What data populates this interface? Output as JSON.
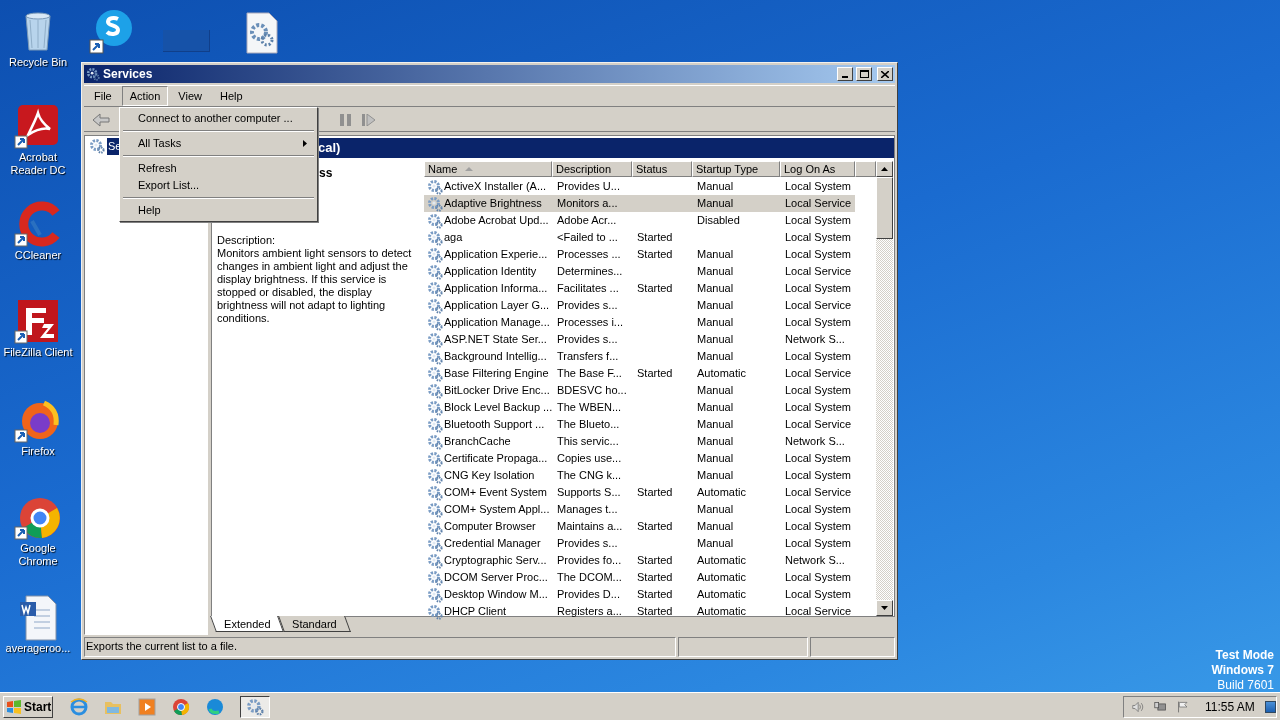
{
  "desktop_icons": [
    {
      "kind": "recycle",
      "label": "Recycle Bin"
    },
    {
      "kind": "acrobat",
      "label": "Acrobat Reader DC"
    },
    {
      "kind": "ccleaner",
      "label": "CCleaner"
    },
    {
      "kind": "filezilla",
      "label": "FileZilla Client"
    },
    {
      "kind": "firefox",
      "label": "Firefox"
    },
    {
      "kind": "chrome",
      "label": "Google Chrome"
    },
    {
      "kind": "word",
      "label": "averageroo..."
    }
  ],
  "window": {
    "title": "Services",
    "menu": [
      {
        "label": "File",
        "selected": false
      },
      {
        "label": "Action",
        "selected": true
      },
      {
        "label": "View",
        "selected": false
      },
      {
        "label": "Help",
        "selected": false
      }
    ],
    "action_menu": [
      [
        {
          "label": "Connect to another computer ...",
          "submenu": false
        }
      ],
      [
        {
          "label": "All Tasks",
          "submenu": true
        }
      ],
      [
        {
          "label": "Refresh",
          "submenu": false
        },
        {
          "label": "Export List...",
          "submenu": false
        }
      ],
      [
        {
          "label": "Help",
          "submenu": false
        }
      ]
    ],
    "tree": [
      {
        "label": "Se",
        "selected": true
      }
    ],
    "pane_header": "cal)",
    "service_title": "ss",
    "description_label": "Description:",
    "description": "Monitors ambient light sensors to detect changes in ambient light and adjust the display brightness.  If this service is stopped or disabled, the display brightness will not adapt to lighting conditions.",
    "table": {
      "columns": [
        {
          "label": "Name",
          "sorted": true
        },
        {
          "label": "Description",
          "sorted": false
        },
        {
          "label": "Status",
          "sorted": false
        },
        {
          "label": "Startup Type",
          "sorted": false
        },
        {
          "label": "Log On As",
          "sorted": false
        }
      ],
      "rows": [
        {
          "cells": [
            "ActiveX Installer (A...",
            "Provides U...",
            "",
            "Manual",
            "Local System"
          ],
          "selected": false
        },
        {
          "cells": [
            "Adaptive Brightness",
            "Monitors a...",
            "",
            "Manual",
            "Local Service"
          ],
          "selected": true
        },
        {
          "cells": [
            "Adobe Acrobat Upd...",
            "Adobe Acr...",
            "",
            "Disabled",
            "Local System"
          ],
          "selected": false
        },
        {
          "cells": [
            "aga",
            "<Failed to ...",
            "Started",
            "",
            "Local System"
          ],
          "selected": false
        },
        {
          "cells": [
            "Application Experie...",
            "Processes ...",
            "Started",
            "Manual",
            "Local System"
          ],
          "selected": false
        },
        {
          "cells": [
            "Application Identity",
            "Determines...",
            "",
            "Manual",
            "Local Service"
          ],
          "selected": false
        },
        {
          "cells": [
            "Application Informa...",
            "Facilitates ...",
            "Started",
            "Manual",
            "Local System"
          ],
          "selected": false
        },
        {
          "cells": [
            "Application Layer G...",
            "Provides s...",
            "",
            "Manual",
            "Local Service"
          ],
          "selected": false
        },
        {
          "cells": [
            "Application Manage...",
            "Processes i...",
            "",
            "Manual",
            "Local System"
          ],
          "selected": false
        },
        {
          "cells": [
            "ASP.NET State Ser...",
            "Provides s...",
            "",
            "Manual",
            "Network S..."
          ],
          "selected": false
        },
        {
          "cells": [
            "Background Intellig...",
            "Transfers f...",
            "",
            "Manual",
            "Local System"
          ],
          "selected": false
        },
        {
          "cells": [
            "Base Filtering Engine",
            "The Base F...",
            "Started",
            "Automatic",
            "Local Service"
          ],
          "selected": false
        },
        {
          "cells": [
            "BitLocker Drive Enc...",
            "BDESVC ho...",
            "",
            "Manual",
            "Local System"
          ],
          "selected": false
        },
        {
          "cells": [
            "Block Level Backup ...",
            "The WBEN...",
            "",
            "Manual",
            "Local System"
          ],
          "selected": false
        },
        {
          "cells": [
            "Bluetooth Support ...",
            "The Blueto...",
            "",
            "Manual",
            "Local Service"
          ],
          "selected": false
        },
        {
          "cells": [
            "BranchCache",
            "This servic...",
            "",
            "Manual",
            "Network S..."
          ],
          "selected": false
        },
        {
          "cells": [
            "Certificate Propaga...",
            "Copies use...",
            "",
            "Manual",
            "Local System"
          ],
          "selected": false
        },
        {
          "cells": [
            "CNG Key Isolation",
            "The CNG k...",
            "",
            "Manual",
            "Local System"
          ],
          "selected": false
        },
        {
          "cells": [
            "COM+ Event System",
            "Supports S...",
            "Started",
            "Automatic",
            "Local Service"
          ],
          "selected": false
        },
        {
          "cells": [
            "COM+ System Appl...",
            "Manages t...",
            "",
            "Manual",
            "Local System"
          ],
          "selected": false
        },
        {
          "cells": [
            "Computer Browser",
            "Maintains a...",
            "Started",
            "Manual",
            "Local System"
          ],
          "selected": false
        },
        {
          "cells": [
            "Credential Manager",
            "Provides s...",
            "",
            "Manual",
            "Local System"
          ],
          "selected": false
        },
        {
          "cells": [
            "Cryptographic Serv...",
            "Provides fo...",
            "Started",
            "Automatic",
            "Network S..."
          ],
          "selected": false
        },
        {
          "cells": [
            "DCOM Server Proc...",
            "The DCOM...",
            "Started",
            "Automatic",
            "Local System"
          ],
          "selected": false
        },
        {
          "cells": [
            "Desktop Window M...",
            "Provides D...",
            "Started",
            "Automatic",
            "Local System"
          ],
          "selected": false
        },
        {
          "cells": [
            "DHCP Client",
            "Registers a...",
            "Started",
            "Automatic",
            "Local Service"
          ],
          "selected": false
        }
      ]
    },
    "view_tabs": [
      {
        "label": "Extended",
        "selected": true
      },
      {
        "label": "Standard",
        "selected": false
      }
    ],
    "status_bar": "Exports the current list to a file."
  },
  "os_notice": [
    "Test Mode",
    "Windows 7",
    "Build 7601"
  ],
  "taskbar": {
    "start": "Start",
    "tasks": [
      {
        "kind": "services",
        "selected": true
      }
    ],
    "clock": "11:55 AM"
  }
}
